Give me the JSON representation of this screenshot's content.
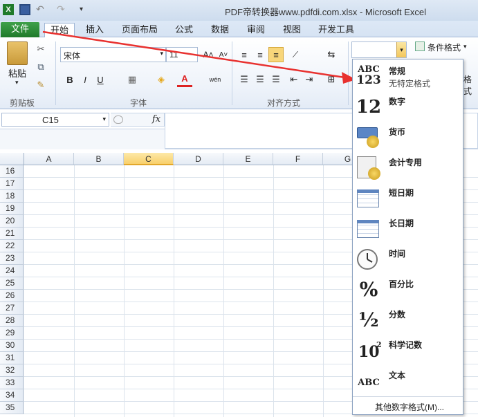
{
  "window": {
    "title": "PDF帝转换器www.pdfdi.com.xlsx  -  Microsoft Excel"
  },
  "tabs": [
    "文件",
    "开始",
    "插入",
    "页面布局",
    "公式",
    "数据",
    "审阅",
    "视图",
    "开发工具"
  ],
  "ribbon": {
    "paste_label": "粘贴",
    "font_name": "宋体",
    "font_size": "11",
    "bold": "B",
    "italic": "I",
    "underline": "U",
    "font_color_label": "A",
    "wen_label": "wén",
    "groups": {
      "clipboard": "剪贴板",
      "font": "字体",
      "alignment": "对齐方式"
    },
    "cond_format": "条件格式",
    "format_label": "格式"
  },
  "formula_bar": {
    "name_box": "C15",
    "fx": "fx"
  },
  "grid": {
    "columns": [
      "A",
      "B",
      "C",
      "D",
      "E",
      "F",
      "G"
    ],
    "selected_column": "C",
    "rows": [
      "16",
      "17",
      "18",
      "19",
      "20",
      "21",
      "22",
      "23",
      "24",
      "25",
      "26",
      "27",
      "28",
      "29",
      "30",
      "31",
      "32",
      "33",
      "34",
      "35"
    ]
  },
  "number_format_menu": {
    "items": [
      {
        "label": "常规",
        "sub": "无特定格式",
        "icon": "abc123-icon"
      },
      {
        "label": "数字",
        "icon": "number-12-icon"
      },
      {
        "label": "货币",
        "icon": "currency-icon"
      },
      {
        "label": "会计专用",
        "icon": "accounting-icon"
      },
      {
        "label": "短日期",
        "icon": "short-date-icon"
      },
      {
        "label": "长日期",
        "icon": "long-date-icon"
      },
      {
        "label": "时间",
        "icon": "clock-icon"
      },
      {
        "label": "百分比",
        "icon": "percent-icon"
      },
      {
        "label": "分数",
        "icon": "fraction-icon"
      },
      {
        "label": "科学记数",
        "icon": "scientific-icon"
      },
      {
        "label": "文本",
        "icon": "text-abc-icon"
      }
    ],
    "more": "其他数字格式(M)...",
    "icon_text": {
      "abc": "ABC",
      "num123": "123",
      "num12": "12",
      "pct": "%",
      "half": "½",
      "ten": "10",
      "sq": "2",
      "txt": "ABC"
    }
  },
  "colors": {
    "accent": "#e8312f",
    "file_tab": "#2a8a35",
    "selected_col": "#f8cf6b"
  }
}
